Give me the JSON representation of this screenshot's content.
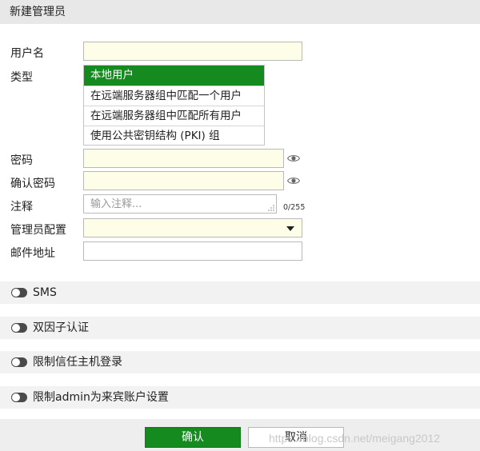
{
  "header": {
    "title": "新建管理员"
  },
  "form": {
    "username_label": "用户名",
    "type_label": "类型",
    "type_options": [
      "本地用户",
      "在远端服务器组中匹配一个用户",
      "在远端服务器组中匹配所有用户",
      "使用公共密钥结构 (PKI) 组"
    ],
    "type_selected": "本地用户",
    "password_label": "密码",
    "confirm_password_label": "确认密码",
    "comment_label": "注释",
    "comment_placeholder": "输入注释...",
    "comment_counter": "0/255",
    "admin_profile_label": "管理员配置",
    "email_label": "邮件地址"
  },
  "sections": [
    {
      "label": "SMS",
      "enabled": false
    },
    {
      "label": "双因子认证",
      "enabled": false
    },
    {
      "label": "限制信任主机登录",
      "enabled": false
    },
    {
      "label": "限制admin为来宾账户设置",
      "enabled": false
    }
  ],
  "footer": {
    "ok_label": "确认",
    "cancel_label": "取消",
    "watermark": "https://blog.csdn.net/meigang2012"
  },
  "colors": {
    "accent_green": "#158a1f",
    "input_bg": "#fefde8",
    "header_bg": "#e8e8e8",
    "section_bg": "#f2f2f2"
  },
  "icons": {
    "password_reveal": "eye-icon",
    "confirm_reveal": "eye-icon",
    "toggle": "toggle-switch-off-icon",
    "select": "caret-down-icon",
    "resize": "resize-grip-icon"
  }
}
